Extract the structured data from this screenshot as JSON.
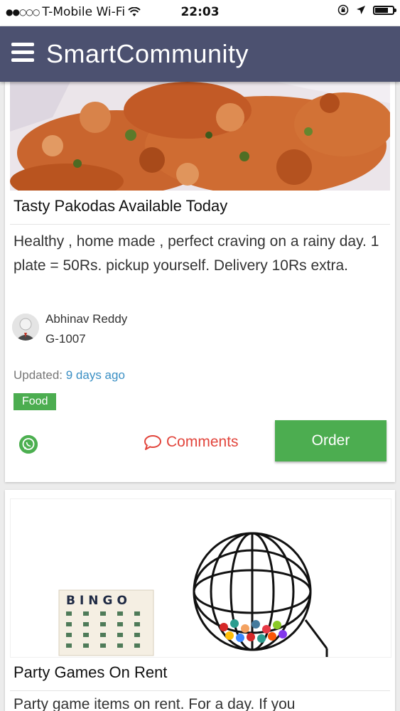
{
  "status_bar": {
    "carrier": "T-Mobile Wi-Fi",
    "time": "22:03"
  },
  "app_bar": {
    "title": "SmartCommunity"
  },
  "posts": [
    {
      "title": "Tasty Pakodas Available Today",
      "description": "Healthy , home made , perfect craving on a rainy day. 1 plate = 50Rs. pickup yourself. Delivery 10Rs extra.",
      "author_name": "Abhinav Reddy",
      "author_unit": "G-1007",
      "updated_label": "Updated:",
      "updated_time": "9 days ago",
      "tag": "Food",
      "comments_label": "Comments",
      "order_label": "Order"
    },
    {
      "title": "Party Games On Rent",
      "description": "Party game items on rent. For a day. If you",
      "image_text": "BINGO"
    }
  ],
  "colors": {
    "app_bar": "#4c5170",
    "green": "#4cad50",
    "comments_red": "#e2453c",
    "link_blue": "#3a8fc4"
  }
}
